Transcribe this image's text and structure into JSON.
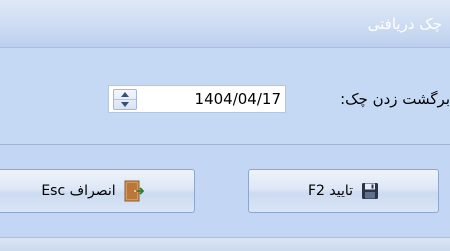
{
  "window": {
    "title": "چک دریافتی"
  },
  "form": {
    "date_label": "برگشت زدن چک:",
    "date_value": "1404/04/17"
  },
  "buttons": {
    "confirm_label": "تایید F2",
    "cancel_label": "انصراف Esc"
  },
  "icons": {
    "confirm": "floppy-disk-icon",
    "cancel": "exit-door-icon"
  }
}
